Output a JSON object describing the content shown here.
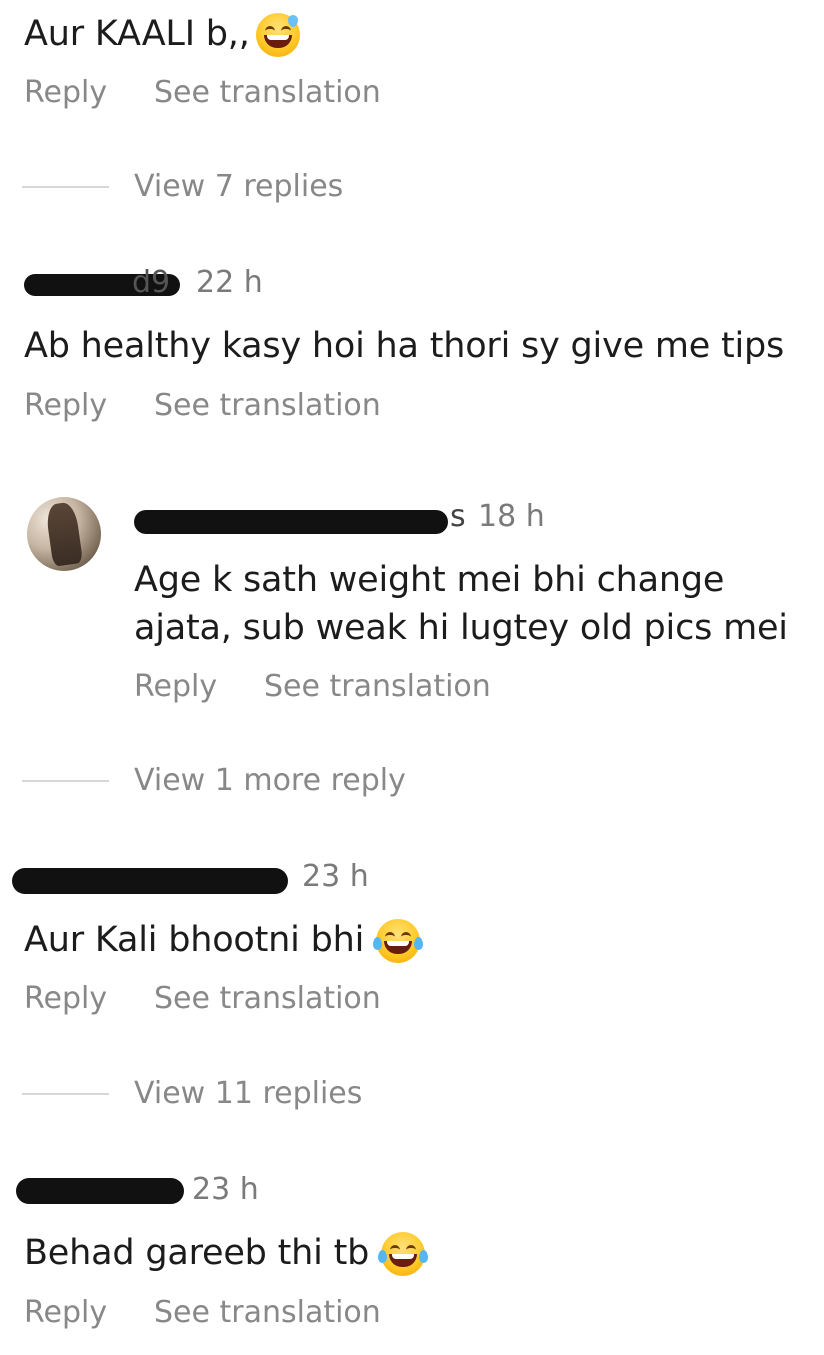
{
  "comments": [
    {
      "id": "c1",
      "text": "Aur KAALI b,,",
      "emoji": "grinning-sweat",
      "actions": {
        "reply": "Reply",
        "translate": "See translation"
      },
      "view_replies": "View 7 replies"
    },
    {
      "id": "c2",
      "username_partial": "d9",
      "time": "22 h",
      "text": "Ab healthy kasy hoi ha thori sy give me tips",
      "actions": {
        "reply": "Reply",
        "translate": "See translation"
      }
    },
    {
      "id": "c3",
      "is_reply": true,
      "username_partial": "s",
      "time": "18 h",
      "text_line1": "Age k sath weight mei bhi change",
      "text_line2": "ajata, sub weak hi lugtey old pics mei",
      "actions": {
        "reply": "Reply",
        "translate": "See translation"
      },
      "view_replies": "View 1 more reply"
    },
    {
      "id": "c4",
      "username_partial": "",
      "time": "23 h",
      "text": "Aur Kali bhootni bhi",
      "emoji": "tears-of-joy",
      "actions": {
        "reply": "Reply",
        "translate": "See translation"
      },
      "view_replies": "View 11 replies"
    },
    {
      "id": "c5",
      "username_partial": "",
      "time": "23 h",
      "text": "Behad gareeb thi tb",
      "emoji": "tears-of-joy",
      "actions": {
        "reply": "Reply",
        "translate": "See translation"
      }
    }
  ],
  "colors": {
    "text": "#1c1c1c",
    "muted": "#888888",
    "divider": "#d7d7d7",
    "redaction": "#111111"
  }
}
